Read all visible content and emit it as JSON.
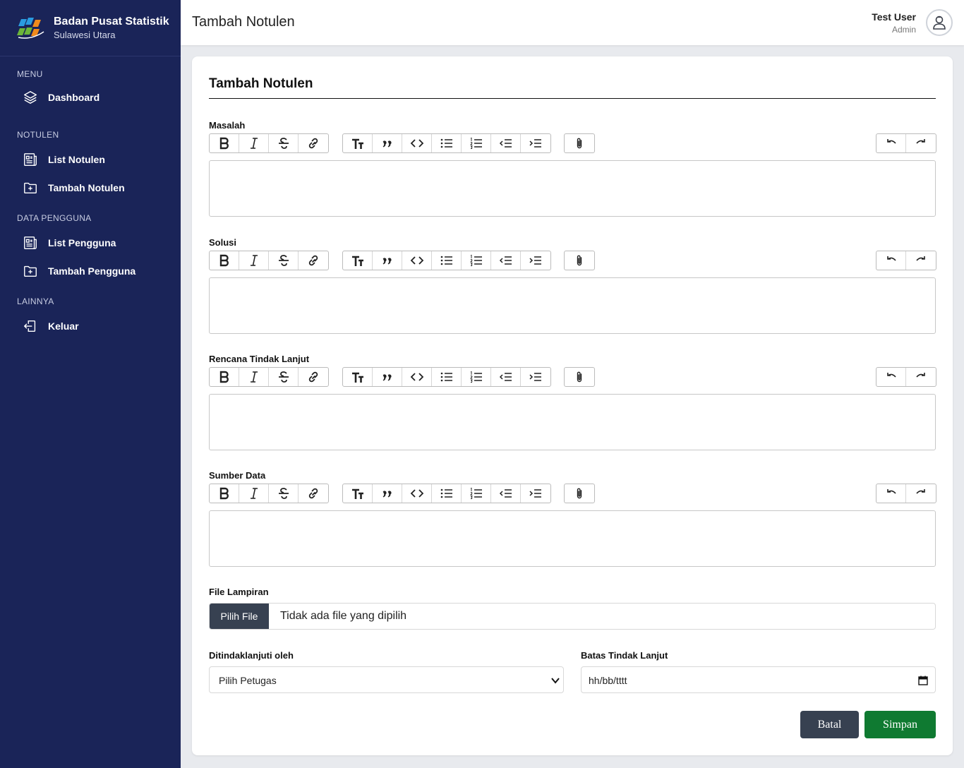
{
  "brand": {
    "name": "Badan Pusat Statistik",
    "region": "Sulawesi Utara"
  },
  "sidebar": {
    "sections": [
      {
        "title": "MENU",
        "items": [
          {
            "label": "Dashboard",
            "icon": "layers-icon"
          }
        ]
      },
      {
        "title": "NOTULEN",
        "items": [
          {
            "label": "List Notulen",
            "icon": "document-list-icon"
          },
          {
            "label": "Tambah Notulen",
            "icon": "folder-plus-icon"
          }
        ]
      },
      {
        "title": "DATA PENGGUNA",
        "items": [
          {
            "label": "List Pengguna",
            "icon": "document-list-icon"
          },
          {
            "label": "Tambah Pengguna",
            "icon": "folder-plus-icon"
          }
        ]
      },
      {
        "title": "LAINNYA",
        "items": [
          {
            "label": "Keluar",
            "icon": "logout-icon"
          }
        ]
      }
    ]
  },
  "header": {
    "title": "Tambah Notulen",
    "user_name": "Test User",
    "user_role": "Admin"
  },
  "form": {
    "title": "Tambah Notulen",
    "editors": [
      {
        "label": "Masalah"
      },
      {
        "label": "Solusi"
      },
      {
        "label": "Rencana Tindak Lanjut"
      },
      {
        "label": "Sumber Data"
      }
    ],
    "file_label": "File Lampiran",
    "file_button": "Pilih File",
    "file_status": "Tidak ada file yang dipilih",
    "assignee_label": "Ditindaklanjuti oleh",
    "assignee_selected": "Pilih Petugas",
    "deadline_label": "Batas Tindak Lanjut",
    "deadline_placeholder": "hh/bb/tttt",
    "cancel_label": "Batal",
    "save_label": "Simpan"
  },
  "colors": {
    "sidebar": "#1a2458",
    "save": "#0f7a31",
    "dark_button": "#374151"
  }
}
